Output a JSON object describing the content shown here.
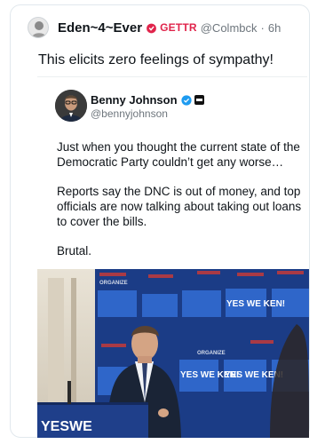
{
  "post": {
    "author_name": "Eden~4~Ever",
    "platform": "GETTR",
    "handle": "@Colmbck",
    "separator": "·",
    "time": "6h",
    "text": "This elicits zero feelings of sympathy!"
  },
  "quoted": {
    "name": "Benny Johnson",
    "handle": "@bennyjohnson",
    "paragraphs": [
      "Just when you thought the current state of the Democratic Party couldn’t get any worse…",
      "Reports say the DNC is out of money, and top officials are now talking about taking out loans to cover the bills.",
      "Brutal."
    ]
  },
  "photo": {
    "signs": [
      "YES WE KEN!",
      "ORGANIZE",
      "YESWE"
    ]
  },
  "colors": {
    "verified": "#1d9bf0",
    "gettr_red": "#e0244b",
    "muted": "#6e767d"
  }
}
